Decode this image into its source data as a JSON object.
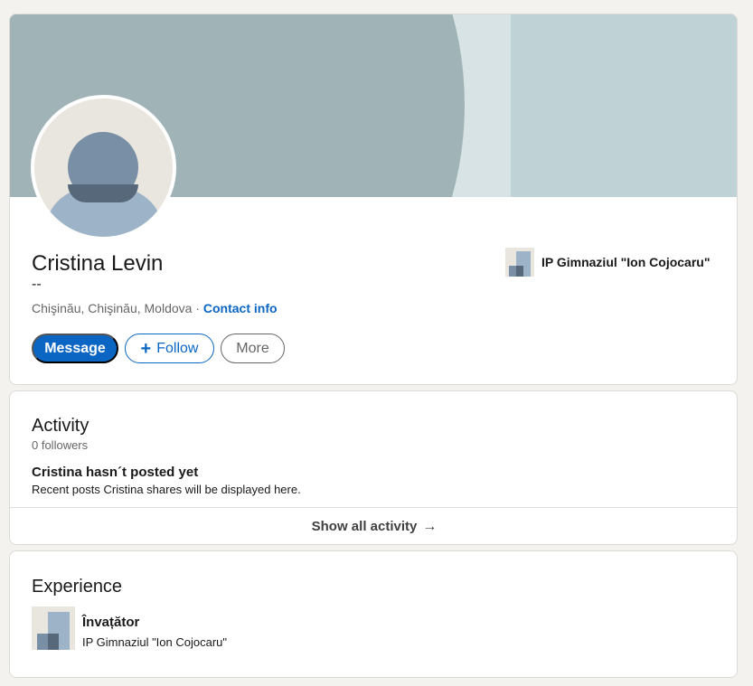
{
  "profile": {
    "name": "Cristina Levin",
    "headline": "--",
    "location": "Chişinău, Chişinău, Moldova",
    "separator": "·",
    "contact_label": "Contact info",
    "company": "IP Gimnaziul \"Ion Cojocaru\"",
    "buttons": {
      "message": "Message",
      "follow_icon": "+",
      "follow": "Follow",
      "more": "More"
    }
  },
  "activity": {
    "title": "Activity",
    "followers": "0 followers",
    "empty_title": "Cristina hasn´t posted yet",
    "empty_subtitle": "Recent posts Cristina shares will be displayed here.",
    "show_all": "Show all activity",
    "show_all_icon": "→"
  },
  "experience": {
    "title": "Experience",
    "items": [
      {
        "title": "Învațător",
        "company": "IP Gimnaziul \"Ion Cojocaru\""
      }
    ]
  },
  "colors": {
    "accent": "#0a66c2",
    "background": "#f4f2ee",
    "banner": "#a0b4b7"
  },
  "icons": {
    "avatar": "default-person-avatar-icon",
    "company_logo": "company-logo-placeholder-icon",
    "arrow": "arrow-right-icon",
    "plus": "plus-icon"
  }
}
